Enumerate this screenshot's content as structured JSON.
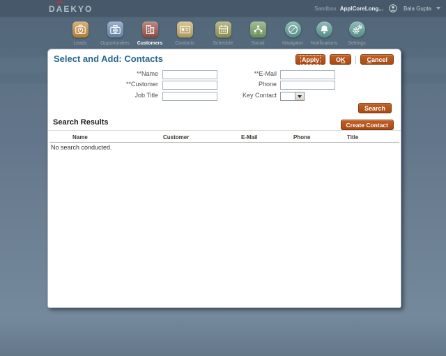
{
  "header": {
    "logo": "DAEKYO",
    "sandbox_label": "Sandbox",
    "sandbox_value": "ApplCoreLong...",
    "user_name": "Bala Gupta"
  },
  "nav": {
    "items": [
      {
        "label": "Leads",
        "icon": "briefcase-icon",
        "color": "#cd9140",
        "shape": "square",
        "active": false
      },
      {
        "label": "Opportunities",
        "icon": "camera-icon",
        "color": "#7394bb",
        "shape": "square",
        "active": false
      },
      {
        "label": "Customers",
        "icon": "building-icon",
        "color": "#a25a50",
        "shape": "square",
        "active": true
      },
      {
        "label": "Contacts",
        "icon": "id-card-icon",
        "color": "#c9b26a",
        "shape": "square",
        "active": false
      },
      {
        "label": "Schedule",
        "icon": "calendar-icon",
        "color": "#a0a05e",
        "shape": "square",
        "active": false
      },
      {
        "label": "Social",
        "icon": "org-people-icon",
        "color": "#7ca469",
        "shape": "square",
        "active": false
      },
      {
        "label": "Navigator",
        "icon": "compass-icon",
        "color": "#62a59b",
        "shape": "circle",
        "active": false
      },
      {
        "label": "Notifications",
        "icon": "bell-icon",
        "color": "#62a59b",
        "shape": "circle",
        "active": false
      },
      {
        "label": "Settings",
        "icon": "gears-icon",
        "color": "#62a59b",
        "shape": "circle",
        "active": false
      }
    ]
  },
  "dialog": {
    "title": "Select and Add: Contacts",
    "buttons": [
      {
        "label": "Apply",
        "mnemonic": "",
        "focused": true
      },
      {
        "label": "OK",
        "mnemonic": "K",
        "focused": false
      },
      {
        "label": "Cancel",
        "mnemonic": "C",
        "focused": false
      }
    ],
    "form": {
      "fields": {
        "name": {
          "label": "**Name",
          "value": ""
        },
        "email": {
          "label": "**E-Mail",
          "value": ""
        },
        "customer": {
          "label": "**Customer",
          "value": ""
        },
        "phone": {
          "label": "Phone",
          "value": ""
        },
        "job_title": {
          "label": "Job Title",
          "value": ""
        },
        "key_contact": {
          "label": "Key Contact",
          "value": ""
        }
      }
    },
    "search_button": "Search",
    "results": {
      "title": "Search Results",
      "create_button": "Create Contact",
      "columns": [
        "Name",
        "Customer",
        "E-Mail",
        "Phone",
        "Title"
      ],
      "empty_message": "No search conducted."
    }
  },
  "colors": {
    "accent_orange": "#b35419",
    "title_blue": "#26688f",
    "topbar_bg": "#46586a",
    "page_bg": "#5f7487"
  }
}
